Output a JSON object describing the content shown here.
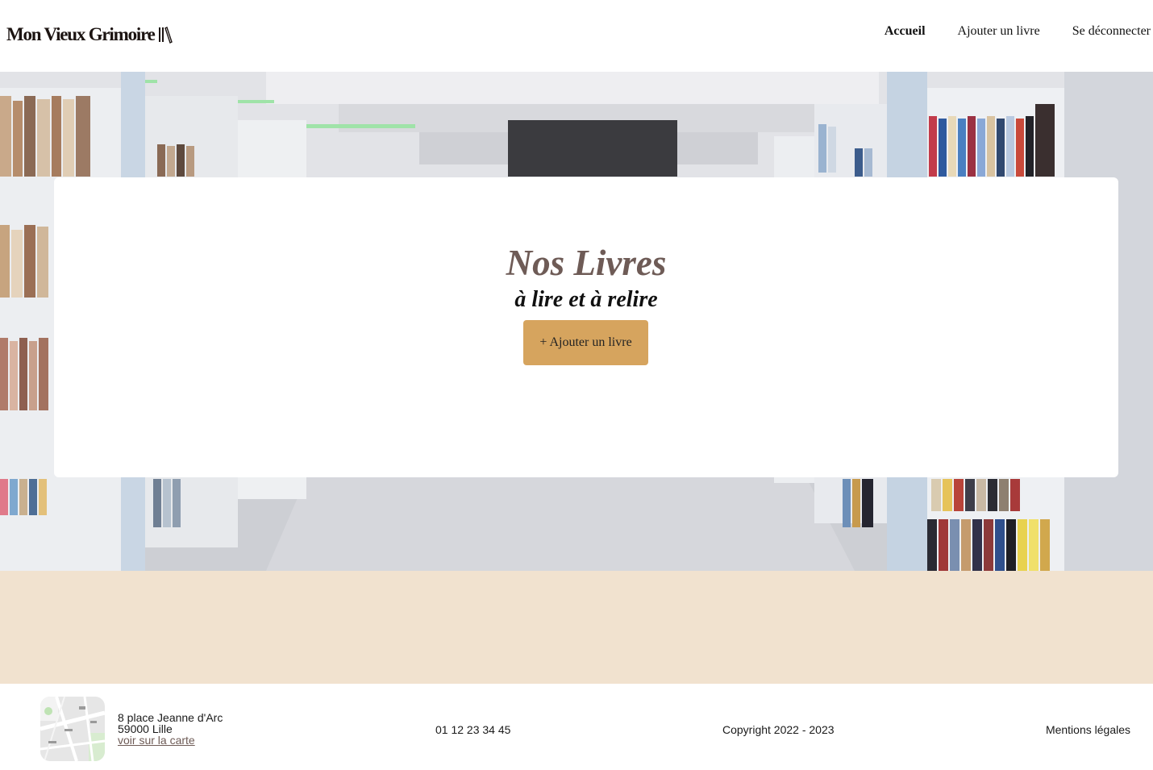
{
  "header": {
    "logo_text": "Mon Vieux Grimoire",
    "logo_icon": "books-icon",
    "nav": [
      {
        "label": "Accueil",
        "active": true
      },
      {
        "label": "Ajouter un livre",
        "active": false
      },
      {
        "label": "Se déconnecter",
        "active": false
      }
    ]
  },
  "hero": {
    "title": "Nos Livres",
    "subtitle": "à lire et à relire",
    "button_label": "+ Ajouter un livre"
  },
  "footer": {
    "address_line1": "8 place Jeanne d'Arc",
    "address_line2": "59000 Lille",
    "map_link": "voir sur la carte",
    "phone": "01 12 23 34 45",
    "copyright": "Copyright 2022 - 2023",
    "legal": "Mentions légales"
  },
  "colors": {
    "accent_button": "#d6a45e",
    "title_color": "#6e5b56",
    "band_color": "#f1e2cf"
  }
}
